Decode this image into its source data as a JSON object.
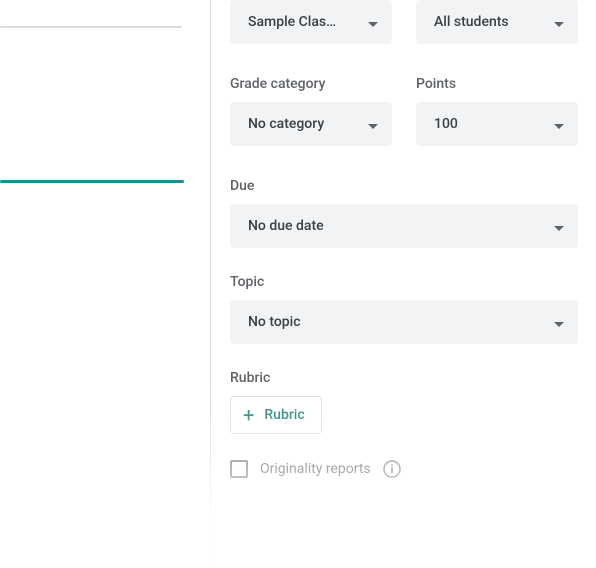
{
  "top_selectors": {
    "class_selector": "Sample Clas…",
    "students_selector": "All students"
  },
  "grade_category": {
    "label": "Grade category",
    "value": "No category"
  },
  "points": {
    "label": "Points",
    "value": "100"
  },
  "due": {
    "label": "Due",
    "value": "No due date"
  },
  "topic": {
    "label": "Topic",
    "value": "No topic"
  },
  "rubric": {
    "label": "Rubric",
    "button": "Rubric"
  },
  "originality": {
    "label": "Originality reports"
  }
}
